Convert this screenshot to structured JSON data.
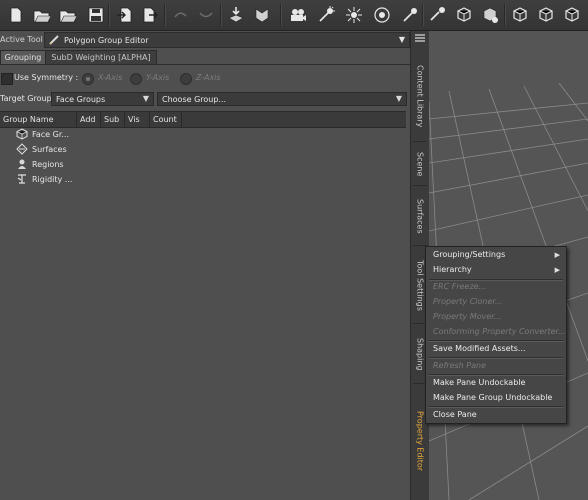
{
  "toolbar": {
    "icons": [
      "new-file-icon",
      "open-folder-icon",
      "open-folder-2-icon",
      "save-icon",
      "import-icon",
      "export-icon",
      "undo-icon",
      "redo-icon",
      "drop-figure-icon",
      "drop-figure-2-icon",
      "camera-icon",
      "spotlight-icon",
      "point-light-icon",
      "distant-light-icon",
      "spot-light-2-icon",
      "sun-icon",
      "cube-icon",
      "cube-2-icon",
      "cube-3-icon",
      "cube-4-icon",
      "cube-5-icon",
      "cube-6-icon"
    ]
  },
  "active_tool": {
    "label": "Active Tool :",
    "value": "Polygon Group Editor"
  },
  "tabs": [
    "Grouping",
    "SubD Weighting [ALPHA]"
  ],
  "symmetry": {
    "label": "Use Symmetry :",
    "x": "X-Axis",
    "y": "Y-Axis",
    "z": "Z-Axis"
  },
  "target_group": {
    "label": "Target Group :",
    "value": "Face Groups",
    "choose": "Choose Group..."
  },
  "columns": [
    "Group Name",
    "Add",
    "Sub",
    "Vis",
    "Count"
  ],
  "tree": [
    "Face Gr...",
    "Surfaces",
    "Regions",
    "Rigidity ..."
  ],
  "side_tabs": [
    "Content Library",
    "Scene",
    "Surfaces",
    "Tool Settings",
    "Shaping",
    "Property Editor"
  ],
  "menu": {
    "items": [
      {
        "label": "Grouping/Settings",
        "submenu": true,
        "enabled": true
      },
      {
        "label": "Hierarchy",
        "submenu": true,
        "enabled": true
      },
      {
        "label": "ERC Freeze...",
        "enabled": false
      },
      {
        "label": "Property Cloner...",
        "enabled": false
      },
      {
        "label": "Property Mover...",
        "enabled": false
      },
      {
        "label": "Conforming Property Converter...",
        "enabled": false
      },
      {
        "label": "Save Modified Assets...",
        "enabled": true
      },
      {
        "label": "Refresh Pane",
        "enabled": false
      },
      {
        "label": "Make Pane Undockable",
        "enabled": true
      },
      {
        "label": "Make Pane Group Undockable",
        "enabled": true
      },
      {
        "label": "Close Pane",
        "enabled": true
      }
    ],
    "submenu_arrow": "▶"
  },
  "colors": {
    "accent": "#e6a83a",
    "panel": "#4f4f4f",
    "viewport": "#545454"
  }
}
